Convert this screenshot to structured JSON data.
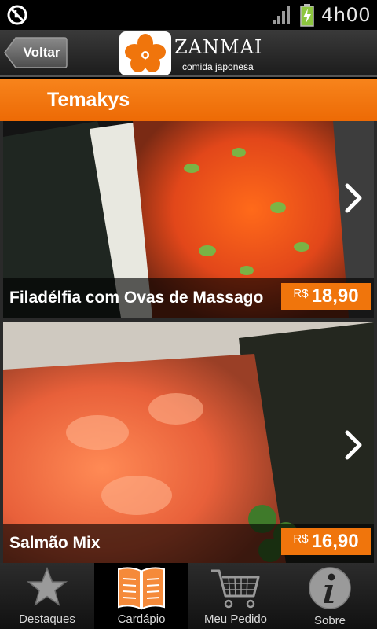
{
  "status_bar": {
    "time": "4h00",
    "icons": [
      "sync-disabled-icon",
      "signal-icon",
      "battery-charging-icon"
    ]
  },
  "header": {
    "back_label": "Voltar",
    "logo_name": "ZANMAI",
    "logo_tagline": "comida japonesa"
  },
  "section": {
    "title": "Temakys"
  },
  "items": [
    {
      "name": "Filadélfia com Ovas de Massago",
      "currency": "R$",
      "price": "18,90",
      "icon": "chevron-right-icon"
    },
    {
      "name": "Salmão Mix",
      "currency": "R$",
      "price": "16,90",
      "icon": "chevron-right-icon"
    }
  ],
  "tabs": [
    {
      "label": "Destaques",
      "icon": "star-icon"
    },
    {
      "label": "Cardápio",
      "icon": "menu-book-icon",
      "active": true
    },
    {
      "label": "Meu Pedido",
      "icon": "cart-icon"
    },
    {
      "label": "Sobre",
      "icon": "info-icon"
    }
  ],
  "colors": {
    "accent": "#f0750c",
    "header": "#2a2a2a",
    "tab_active": "#000000"
  }
}
